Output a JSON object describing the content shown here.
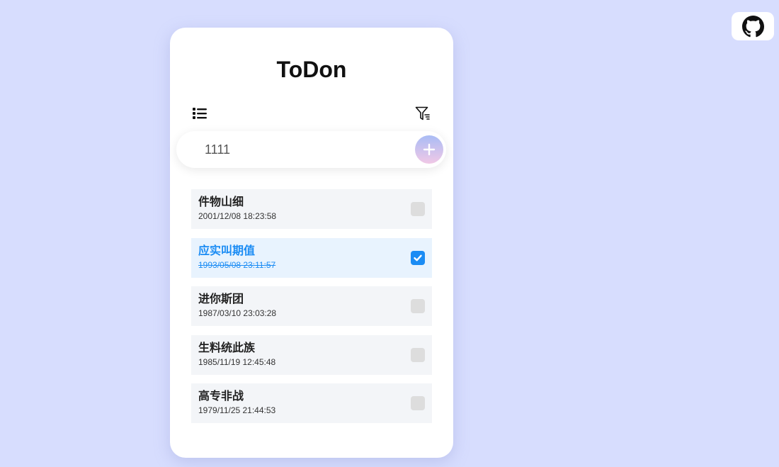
{
  "app": {
    "title": "ToDon"
  },
  "header": {
    "list_icon": "list-icon",
    "filter_icon": "filter-icon"
  },
  "input": {
    "value": "1111",
    "add_icon": "plus-icon"
  },
  "github": {
    "icon": "github-icon"
  },
  "todos": [
    {
      "name": "件物山细",
      "date": "2001/12/08 18:23:58",
      "done": false
    },
    {
      "name": "应实叫期值",
      "date": "1993/05/08 23:11:57",
      "done": true
    },
    {
      "name": "进你斯团",
      "date": "1987/03/10 23:03:28",
      "done": false
    },
    {
      "name": "生料统此族",
      "date": "1985/11/19 12:45:48",
      "done": false
    },
    {
      "name": "高专非战",
      "date": "1979/11/25 21:44:53",
      "done": false
    }
  ],
  "colors": {
    "background": "#d7ddfe",
    "card": "#ffffff",
    "item": "#f3f5f8",
    "item_done": "#e8f3fe",
    "accent": "#1b8cf4",
    "checkbox_off": "#dddddd",
    "add_gradient_top": "#a9bcf5",
    "add_gradient_bottom": "#f1c8e6"
  }
}
